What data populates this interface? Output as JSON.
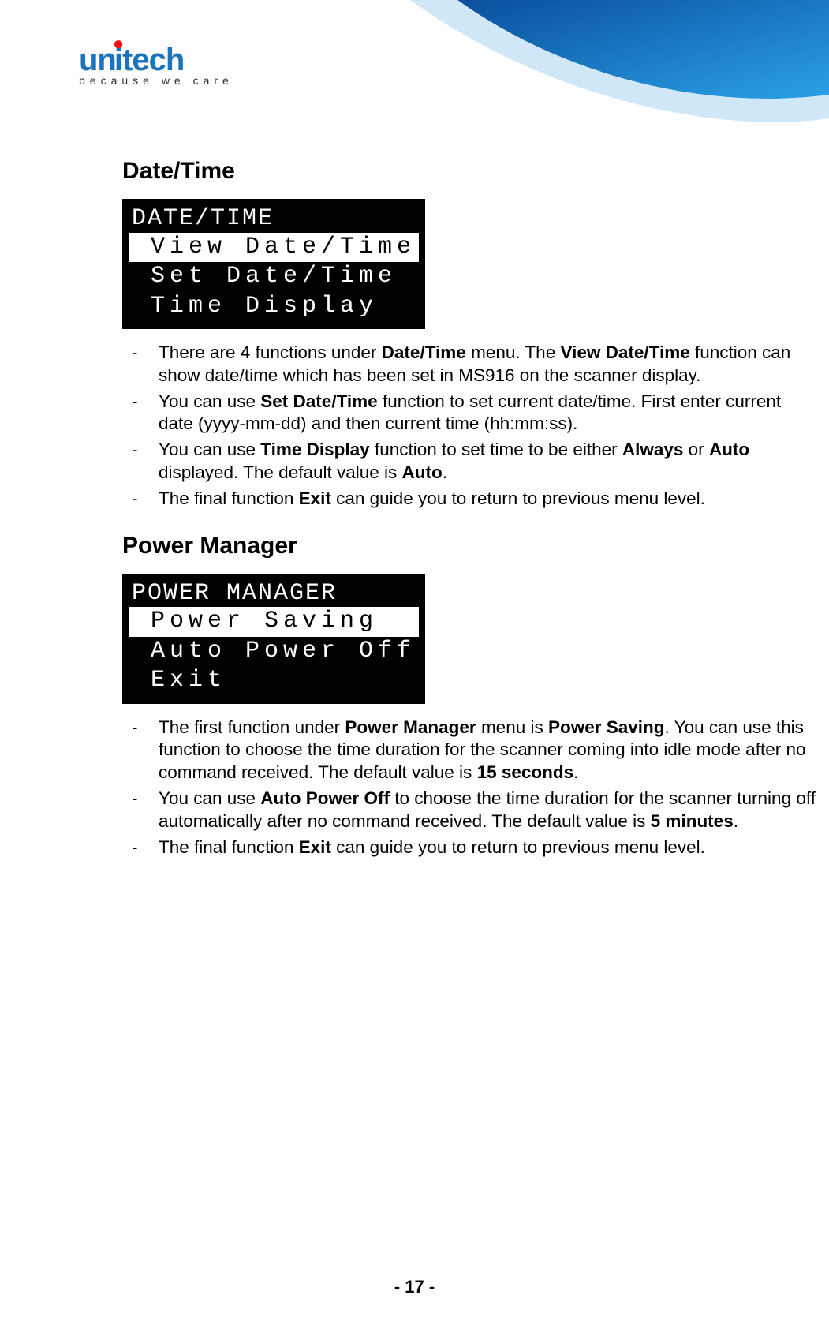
{
  "logo": {
    "wordmark_prefix": "un",
    "wordmark_suffix": "tech",
    "tagline": "because we care"
  },
  "sections": {
    "datetime": {
      "heading": "Date/Time",
      "lcd": {
        "title": "DATE/TIME",
        "rows": [
          {
            "text": "View Date/Time",
            "selected": true
          },
          {
            "text": "Set Date/Time",
            "selected": false
          },
          {
            "text": "Time Display",
            "selected": false
          }
        ]
      },
      "bullets": [
        [
          {
            "t": "There are 4 functions under "
          },
          {
            "t": "Date/Time",
            "b": true
          },
          {
            "t": " menu. The "
          },
          {
            "t": "View Date/Time",
            "b": true
          },
          {
            "t": " function can show date/time which has been set in MS916 on the scanner display."
          }
        ],
        [
          {
            "t": "You can use "
          },
          {
            "t": "Set Date/Time",
            "b": true
          },
          {
            "t": " function to set current date/time. First enter current date (yyyy-mm-dd) and then current time (hh:mm:ss)."
          }
        ],
        [
          {
            "t": "You can use "
          },
          {
            "t": "Time Display",
            "b": true
          },
          {
            "t": " function to set time to be either "
          },
          {
            "t": "Always",
            "b": true
          },
          {
            "t": " or "
          },
          {
            "t": "Auto",
            "b": true
          },
          {
            "t": " displayed. The default value is "
          },
          {
            "t": "Auto",
            "b": true
          },
          {
            "t": "."
          }
        ],
        [
          {
            "t": "The final function "
          },
          {
            "t": "Exit",
            "b": true
          },
          {
            "t": " can guide you to return to previous menu level."
          }
        ]
      ]
    },
    "power": {
      "heading": "Power Manager",
      "lcd": {
        "title": "POWER MANAGER",
        "rows": [
          {
            "text": "Power Saving",
            "selected": true
          },
          {
            "text": "Auto Power Off",
            "selected": false
          },
          {
            "text": "Exit",
            "selected": false
          }
        ]
      },
      "bullets": [
        [
          {
            "t": "The first function under "
          },
          {
            "t": "Power Manager",
            "b": true
          },
          {
            "t": " menu is "
          },
          {
            "t": "Power Saving",
            "b": true
          },
          {
            "t": ". You can use this function to choose the time duration for the scanner coming into idle mode after no command received. The default value is "
          },
          {
            "t": "15 seconds",
            "b": true
          },
          {
            "t": "."
          }
        ],
        [
          {
            "t": "You can use "
          },
          {
            "t": "Auto Power Off",
            "b": true
          },
          {
            "t": " to choose the time duration for the scanner turning off automatically after no command received. The default value is "
          },
          {
            "t": "5 minutes",
            "b": true
          },
          {
            "t": "."
          }
        ],
        [
          {
            "t": "The final function "
          },
          {
            "t": "Exit",
            "b": true
          },
          {
            "t": " can guide you to return to previous menu level."
          }
        ]
      ]
    }
  },
  "footer": "- 17 -"
}
